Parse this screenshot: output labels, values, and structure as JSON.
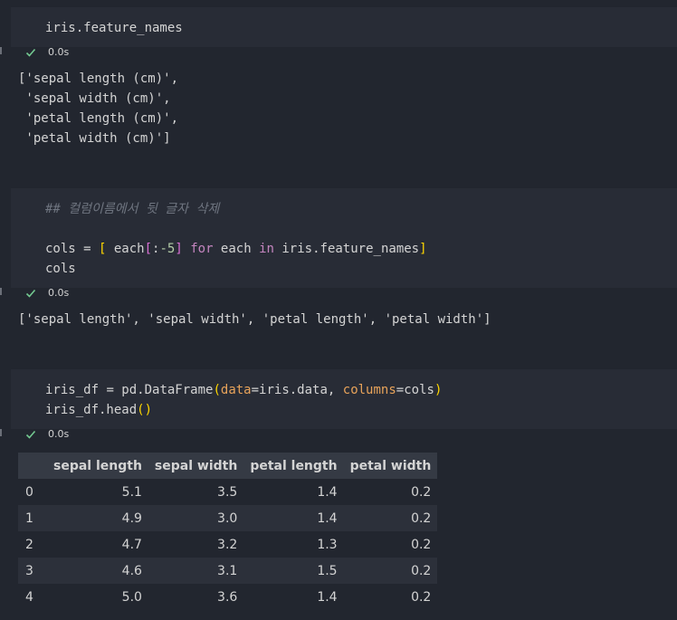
{
  "cells": [
    {
      "code_lines": [
        "iris.feature_names"
      ],
      "exec_time": "0.0s",
      "output_lines": [
        "['sepal length (cm)',",
        " 'sepal width (cm)',",
        " 'petal length (cm)',",
        " 'petal width (cm)']"
      ]
    },
    {
      "code": {
        "comment": "## 컬럼이름에서 뒷 글자 삭제",
        "l2_cols": "cols",
        "l2_eq": " = ",
        "l2_open": "[",
        "l2_each": " each",
        "l2_slice_open": "[",
        "l2_colon": ":",
        "l2_num": "-5",
        "l2_slice_close": "]",
        "l2_for": " for",
        "l2_each2": " each",
        "l2_in": " in",
        "l2_rest": " iris.feature_names",
        "l2_close": "]",
        "l3": "cols"
      },
      "exec_time": "0.0s",
      "output_lines": [
        "['sepal length', 'sepal width', 'petal length', 'petal width']"
      ]
    },
    {
      "code": {
        "l1_a": "iris_df",
        "l1_b": " = pd.DataFrame",
        "l1_open": "(",
        "l1_p1": "data",
        "l1_v1": "=iris.data, ",
        "l1_p2": "columns",
        "l1_v2": "=cols",
        "l1_close": ")",
        "l2_a": "iris_df.head",
        "l2_paren": "()"
      },
      "exec_time": "0.0s"
    }
  ],
  "dataframe": {
    "columns": [
      "",
      "sepal length",
      "sepal width",
      "petal length",
      "petal width"
    ],
    "rows": [
      [
        "0",
        "5.1",
        "3.5",
        "1.4",
        "0.2"
      ],
      [
        "1",
        "4.9",
        "3.0",
        "1.4",
        "0.2"
      ],
      [
        "2",
        "4.7",
        "3.2",
        "1.3",
        "0.2"
      ],
      [
        "3",
        "4.6",
        "3.1",
        "1.5",
        "0.2"
      ],
      [
        "4",
        "5.0",
        "3.6",
        "1.4",
        "0.2"
      ]
    ]
  }
}
